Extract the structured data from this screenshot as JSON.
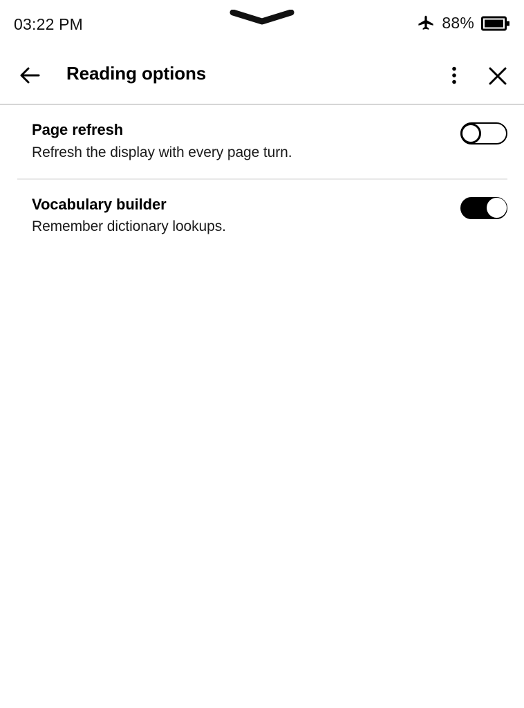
{
  "status_bar": {
    "time": "03:22 PM",
    "battery_percent": "88%",
    "battery_level": 88,
    "airplane_mode_icon": "airplane-icon",
    "battery_icon": "battery-icon",
    "pull_handle_icon": "chevron-down-handle-icon"
  },
  "header": {
    "title": "Reading options",
    "back_icon": "arrow-left-icon",
    "overflow_icon": "more-vertical-icon",
    "close_icon": "close-x-icon"
  },
  "settings": [
    {
      "title": "Page refresh",
      "description": "Refresh the display with every page turn.",
      "toggle_state": "off"
    },
    {
      "title": "Vocabulary builder",
      "description": "Remember dictionary lookups.",
      "toggle_state": "on"
    }
  ],
  "colors": {
    "background": "#ffffff",
    "foreground": "#000000",
    "header_divider": "#d6d6d6",
    "row_divider": "#e8e8e8"
  }
}
